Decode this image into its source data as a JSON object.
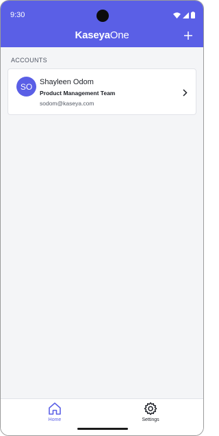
{
  "status_bar": {
    "time": "9:30",
    "icons": [
      "wifi-icon",
      "signal-icon",
      "battery-icon"
    ]
  },
  "header": {
    "logo_part1": "Kaseya",
    "logo_part2": "One",
    "add_icon": "plus-icon",
    "color": "#5a5fe6"
  },
  "accounts": {
    "section_title": "ACCOUNTS",
    "items": [
      {
        "initials": "SO",
        "name": "Shayleen Odom",
        "team": "Product Management Team",
        "email": "sodom@kaseya.com",
        "chevron_icon": "chevron-right-icon"
      }
    ]
  },
  "bottom_nav": {
    "items": [
      {
        "label": "Home",
        "icon": "home-icon",
        "active": true
      },
      {
        "label": "Settings",
        "icon": "gear-icon",
        "active": false
      }
    ]
  }
}
